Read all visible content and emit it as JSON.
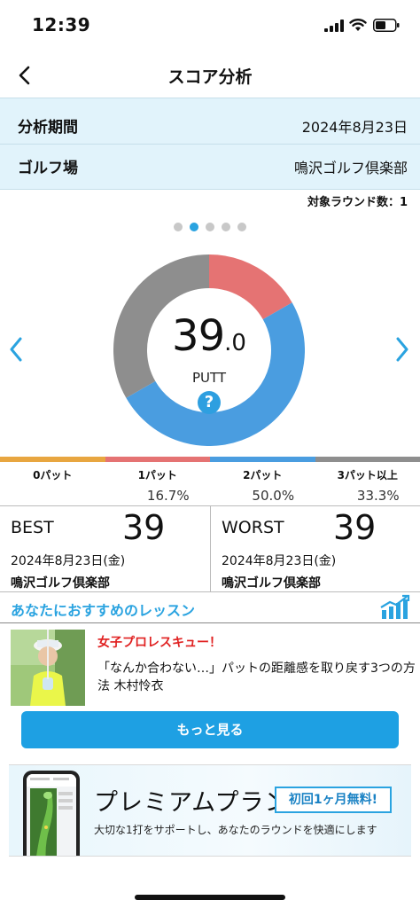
{
  "status_bar": {
    "time": "12:39"
  },
  "nav": {
    "title": "スコア分析"
  },
  "info": {
    "period_label": "分析期間",
    "period_value": "2024年8月23日",
    "course_label": "ゴルフ場",
    "course_value": "鳴沢ゴルフ倶楽部"
  },
  "rounds_count": "対象ラウンド数：1",
  "carousel": {
    "page_count": 5,
    "active_index": 1
  },
  "summary": {
    "value_main": "39",
    "value_decimal": ".0",
    "unit": "PUTT",
    "help_symbol": "?"
  },
  "chart_data": {
    "type": "pie",
    "series": [
      {
        "label": "0パット",
        "value": 0.0,
        "display": "",
        "color": "#e8a640"
      },
      {
        "label": "1パット",
        "value": 16.7,
        "display": "16.7%",
        "color": "#e57373"
      },
      {
        "label": "2パット",
        "value": 50.0,
        "display": "50.0%",
        "color": "#4a9de0"
      },
      {
        "label": "3パット以上",
        "value": 33.3,
        "display": "33.3%",
        "color": "#8e8e8e"
      }
    ]
  },
  "best": {
    "label": "BEST",
    "value": "39",
    "date": "2024年8月23日(金)",
    "course": "鳴沢ゴルフ倶楽部"
  },
  "worst": {
    "label": "WORST",
    "value": "39",
    "date": "2024年8月23日(金)",
    "course": "鳴沢ゴルフ倶楽部"
  },
  "lessons": {
    "title": "あなたにおすすめのレッスン",
    "item": {
      "tag": "女子プロレスキュー！",
      "description": "「なんか合わない…」パットの距離感を取り戻す3つの方法 木村怜衣"
    },
    "more_label": "もっと見る"
  },
  "premium": {
    "title": "プレミアムプラン",
    "badge": "初回1ヶ月無料!",
    "subtitle": "大切な1打をサポートし、あなたのラウンドを快適にします"
  },
  "colors": {
    "accent": "#2aa3e0",
    "info_bg": "#e1f3fb",
    "tag_red": "#e02020"
  }
}
